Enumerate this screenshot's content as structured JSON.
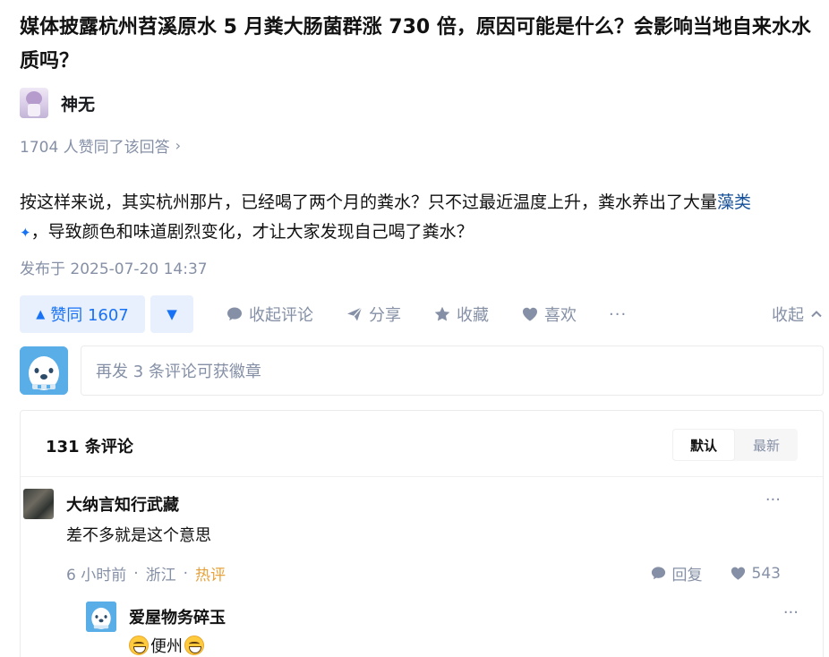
{
  "question": {
    "title": "媒体披露杭州苕溪原水 5 月粪大肠菌群涨 730 倍，原因可能是什么？会影响当地自来水水质吗？"
  },
  "answer": {
    "author_name": "神无",
    "upvote_summary": "1704 人赞同了该回答",
    "body_before_link": "按这样来说，其实杭州那片，已经喝了两个月的粪水？只不过最近温度上升，粪水养出了大量",
    "body_link": "藻类",
    "body_after_link": "，导致颜色和味道剧烈变化，才让大家发现自己喝了粪水？",
    "publish_time": "发布于 2025-07-20 14:37"
  },
  "actionbar": {
    "upvote_label": "赞同 1607",
    "comments_label": "收起评论",
    "share_label": "分享",
    "favorite_label": "收藏",
    "like_label": "喜欢",
    "more_label": "···",
    "collapse_label": "收起"
  },
  "comment_input": {
    "placeholder": "再发 3 条评论可获徽章"
  },
  "comments": {
    "count_label": "131 条评论",
    "sort_options": [
      "默认",
      "最新"
    ],
    "active_sort": "默认",
    "items": [
      {
        "author": "大纳言知行武藏",
        "text": "差不多就是这个意思",
        "time": "6 小时前",
        "location": "浙江",
        "tag": "热评",
        "reply_label": "回复",
        "likes": "543",
        "more": "···"
      }
    ],
    "replies": [
      {
        "author": "爱屋物务碎玉",
        "text": "便州",
        "more": "···"
      }
    ]
  }
}
